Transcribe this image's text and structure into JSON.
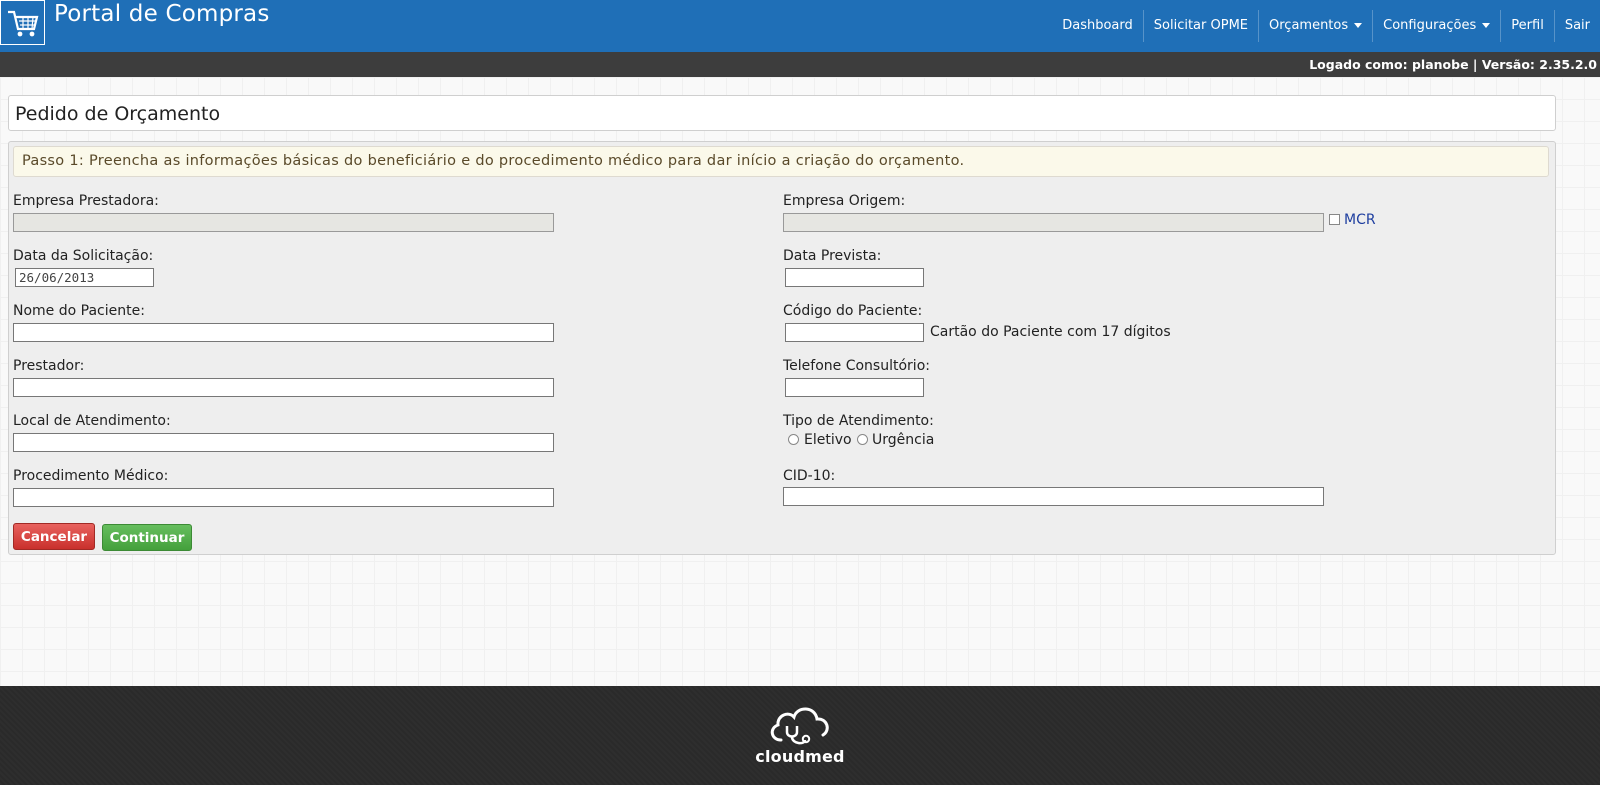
{
  "header": {
    "app_title": "Portal de Compras",
    "nav": {
      "dashboard": "Dashboard",
      "solicitar": "Solicitar OPME",
      "orcamentos": "Orçamentos",
      "configuracoes": "Configurações",
      "perfil": "Perfil",
      "sair": "Sair"
    }
  },
  "status": {
    "text": "Logado como: planobe | Versão: 2.35.2.0"
  },
  "page": {
    "title": "Pedido de Orçamento"
  },
  "alert": {
    "text": "Passo 1: Preencha as informações básicas do beneficiário e do procedimento médico para dar início a criação do orçamento."
  },
  "form": {
    "empresa_prestadora": {
      "label": "Empresa Prestadora:",
      "value": ""
    },
    "data_solicitacao": {
      "label": "Data da Solicitação:",
      "value": "26/06/2013"
    },
    "nome_paciente": {
      "label": "Nome do Paciente:",
      "value": ""
    },
    "prestador": {
      "label": "Prestador:",
      "value": ""
    },
    "local_atendimento": {
      "label": "Local de Atendimento:",
      "value": ""
    },
    "procedimento": {
      "label": "Procedimento Médico:",
      "value": ""
    },
    "empresa_origem": {
      "label": "Empresa Origem:",
      "value": "",
      "checkbox_label": "MCR",
      "checked": false
    },
    "data_prevista": {
      "label": "Data Prevista:",
      "value": ""
    },
    "codigo_paciente": {
      "label": "Código do Paciente:",
      "value": "",
      "hint": "Cartão do Paciente com 17 dígitos"
    },
    "telefone": {
      "label": "Telefone Consultório:",
      "value": ""
    },
    "tipo_atendimento": {
      "label": "Tipo de Atendimento:",
      "options": [
        "Eletivo",
        "Urgência"
      ],
      "selected": null
    },
    "cid10": {
      "label": "CID-10:",
      "value": ""
    }
  },
  "buttons": {
    "cancel": "Cancelar",
    "continue": "Continuar"
  },
  "footer": {
    "brand": "cloudmed"
  },
  "colors": {
    "header_blue": "#1f6fb7",
    "status_bar": "#3d3d3d",
    "cancel_red": "#c9302c",
    "continue_green": "#44a03c",
    "footer": "#2a2a2a"
  },
  "icons": {
    "logo": "shopping-cart-icon",
    "footer": "cloud-stethoscope-icon"
  }
}
